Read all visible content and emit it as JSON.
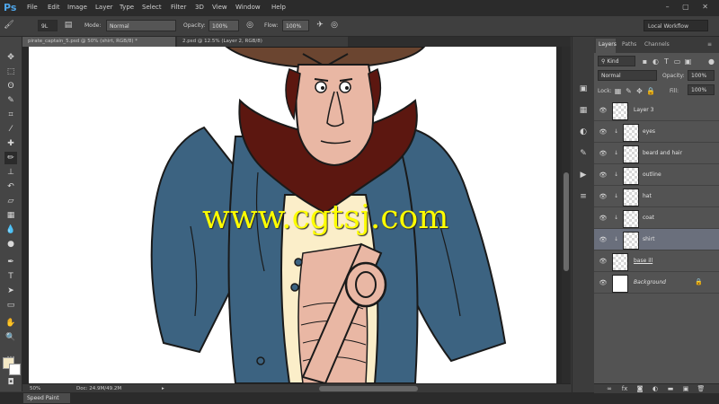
{
  "app": {
    "logo": "Ps"
  },
  "menu": [
    "File",
    "Edit",
    "Image",
    "Layer",
    "Type",
    "Select",
    "Filter",
    "3D",
    "View",
    "Window",
    "Help"
  ],
  "window_controls": "– ▢ ✕",
  "options_bar": {
    "brush_size": "9L",
    "mode_label": "Mode:",
    "mode_value": "Normal",
    "opacity_label": "Opacity:",
    "opacity_value": "100%",
    "flow_label": "Flow:",
    "flow_value": "100%",
    "workspace": "Local Workflow"
  },
  "tabs": [
    {
      "label": "pirate_captain_5.psd @ 50% (shirt, RGB/8) *"
    },
    {
      "label": "2.psd @ 12.5% (Layer 2, RGB/8)"
    }
  ],
  "tools": [
    "move-tool-icon",
    "marquee-tool-icon",
    "lasso-tool-icon",
    "quick-select-tool-icon",
    "crop-tool-icon",
    "eyedropper-tool-icon",
    "healing-tool-icon",
    "brush-tool-icon",
    "clone-stamp-tool-icon",
    "history-brush-tool-icon",
    "eraser-tool-icon",
    "gradient-tool-icon",
    "blur-tool-icon",
    "dodge-tool-icon",
    "pen-tool-icon",
    "type-tool-icon",
    "path-select-tool-icon",
    "shape-tool-icon",
    "hand-tool-icon",
    "zoom-tool-icon"
  ],
  "colors": {
    "foreground": "#f4e9c6",
    "background": "#ffffff",
    "accent": "#4fa6ea",
    "watermark": "#ffff00"
  },
  "watermark": "www.cgtsj.com",
  "status": {
    "zoom": "50%",
    "doc": "Doc: 24.9M/49.2M"
  },
  "bottom_tab": "Speed Paint",
  "layers_panel": {
    "tabs": [
      "Layers",
      "Paths",
      "Channels"
    ],
    "kind_label": "Kind",
    "blend_mode": "Normal",
    "opacity_label": "Opacity:",
    "opacity_value": "100%",
    "lock_label": "Lock:",
    "fill_label": "Fill:",
    "fill_value": "100%",
    "layers": [
      {
        "name": "Layer 3"
      },
      {
        "name": "eyes"
      },
      {
        "name": "beard and hair"
      },
      {
        "name": "outline"
      },
      {
        "name": "hat"
      },
      {
        "name": "coat"
      },
      {
        "name": "shirt"
      },
      {
        "name": "base ill"
      },
      {
        "name": "Background"
      }
    ]
  }
}
